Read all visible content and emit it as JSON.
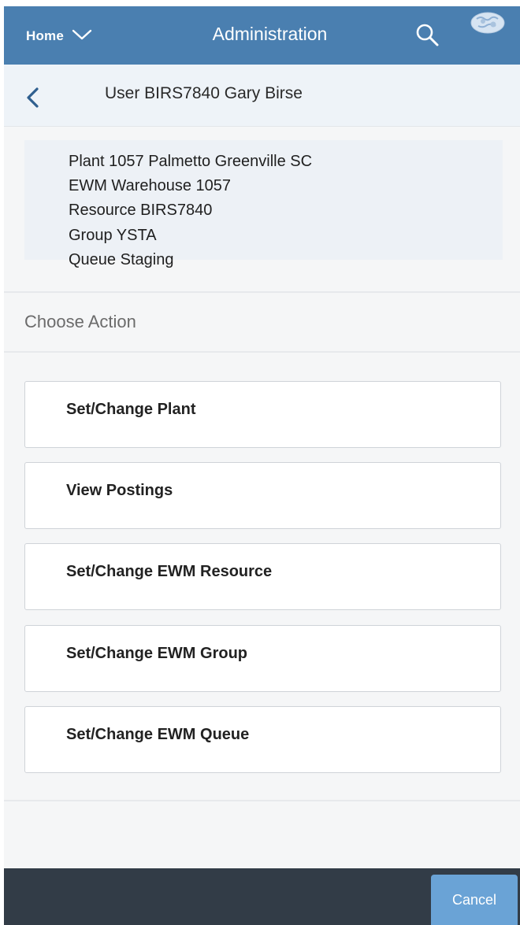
{
  "header": {
    "home_label": "Home",
    "title": "Administration",
    "icons": {
      "home_menu": "chevron-down-icon",
      "search": "search-icon",
      "language": "globe-icon"
    },
    "background": "#4a7fb0"
  },
  "subheader": {
    "title": "User BIRS7840 Gary Birse",
    "back_icon": "chevron-left-icon"
  },
  "info": {
    "lines": [
      "Plant 1057 Palmetto Greenville SC",
      "EWM Warehouse 1057",
      "Resource BIRS7840",
      "Group YSTA",
      "Queue Staging"
    ]
  },
  "section_label": "Choose Action",
  "actions": [
    "Set/Change Plant",
    "View Postings",
    "Set/Change EWM Resource",
    "Set/Change EWM Group",
    "Set/Change EWM Queue"
  ],
  "footer": {
    "cancel_label": "Cancel",
    "cancel_color": "#6aa3d6",
    "background": "#323c47"
  }
}
